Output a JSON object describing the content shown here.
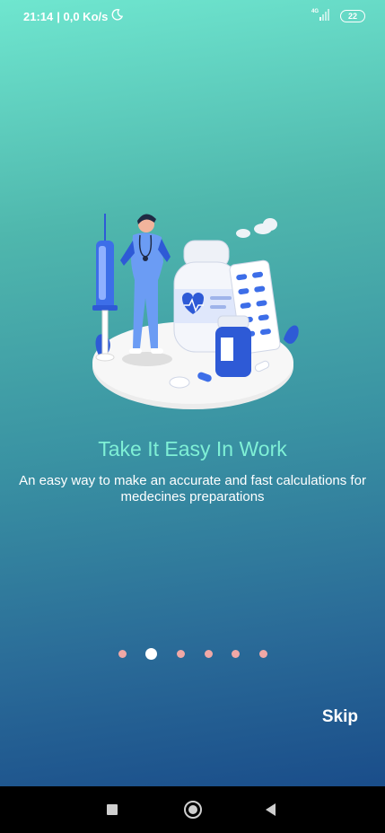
{
  "status_bar": {
    "time": "21:14",
    "speed": "| 0,0 Ko/s",
    "network": "4G",
    "battery": "22"
  },
  "onboarding": {
    "title": "Take It Easy In Work",
    "subtitle": "An easy way to make an accurate and fast calculations for medecines preparations",
    "page_count": 6,
    "active_page": 2,
    "skip_label": "Skip"
  },
  "nav": {
    "square_icon": "recents-square-icon",
    "home_icon": "home-circle-icon",
    "back_icon": "back-triangle-icon"
  },
  "colors": {
    "title": "#7ff0d6",
    "dot_inactive": "#f0a8a6",
    "dot_active": "#ffffff",
    "gradient_top": "#6fe6cf",
    "gradient_bottom": "#1a4d8a"
  }
}
